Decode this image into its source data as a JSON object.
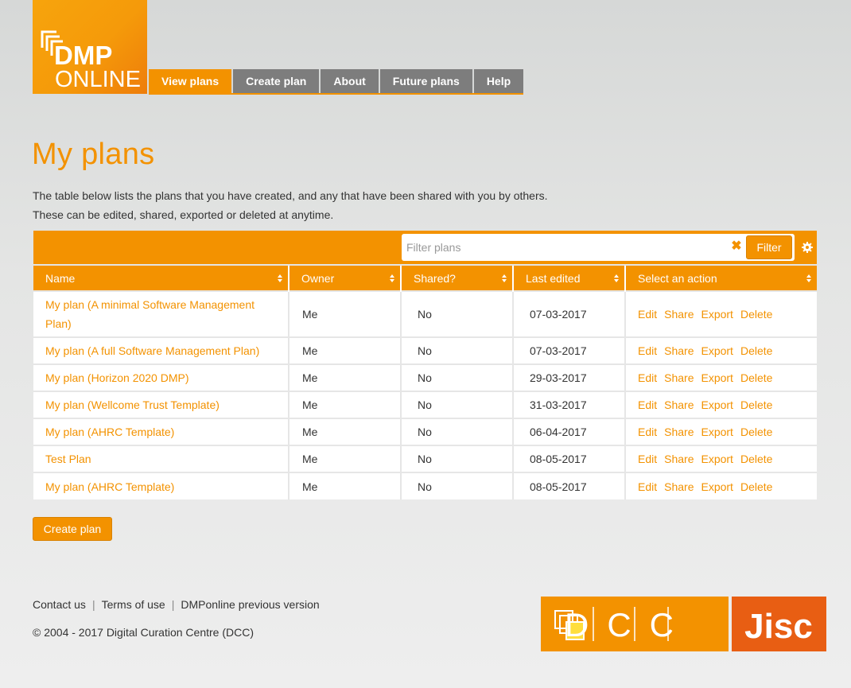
{
  "brand": {
    "logo_line1": "DMP",
    "logo_line2": "ONLINE",
    "accent_color": "#f39200"
  },
  "nav": {
    "items": [
      {
        "label": "View plans",
        "active": true
      },
      {
        "label": "Create plan",
        "active": false
      },
      {
        "label": "About",
        "active": false
      },
      {
        "label": "Future plans",
        "active": false
      },
      {
        "label": "Help",
        "active": false
      }
    ]
  },
  "page": {
    "title": "My plans",
    "intro_line1": "The table below lists the plans that you have created, and any that have been shared with you by others.",
    "intro_line2": "These can be edited, shared, exported or deleted at anytime."
  },
  "filter": {
    "placeholder": "Filter plans",
    "button_label": "Filter",
    "clear_icon": "close-icon",
    "settings_icon": "gear-icon"
  },
  "table": {
    "headers": [
      "Name",
      "Owner",
      "Shared?",
      "Last edited",
      "Select an action"
    ],
    "rows": [
      {
        "name": "My plan (A minimal Software Management Plan)",
        "owner": "Me",
        "shared": "No",
        "edited": "07-03-2017"
      },
      {
        "name": "My plan (A full Software Management Plan)",
        "owner": "Me",
        "shared": "No",
        "edited": "07-03-2017"
      },
      {
        "name": "My plan (Horizon 2020 DMP)",
        "owner": "Me",
        "shared": "No",
        "edited": "29-03-2017"
      },
      {
        "name": "My plan (Wellcome Trust Template)",
        "owner": "Me",
        "shared": "No",
        "edited": "31-03-2017"
      },
      {
        "name": "My plan (AHRC Template)",
        "owner": "Me",
        "shared": "No",
        "edited": "06-04-2017"
      },
      {
        "name": "Test Plan",
        "owner": "Me",
        "shared": "No",
        "edited": "08-05-2017"
      },
      {
        "name": "My plan (AHRC Template)",
        "owner": "Me",
        "shared": "No",
        "edited": "08-05-2017"
      }
    ],
    "actions": [
      "Edit",
      "Share",
      "Export",
      "Delete"
    ]
  },
  "create_button_label": "Create plan",
  "footer": {
    "links": [
      "Contact us",
      "Terms of use",
      "DMPonline previous version"
    ],
    "separator": "|",
    "copyright": "© 2004 - 2017 Digital Curation Centre (DCC)",
    "dcc_logo_text": "DCC",
    "jisc_logo_text": "Jisc"
  }
}
